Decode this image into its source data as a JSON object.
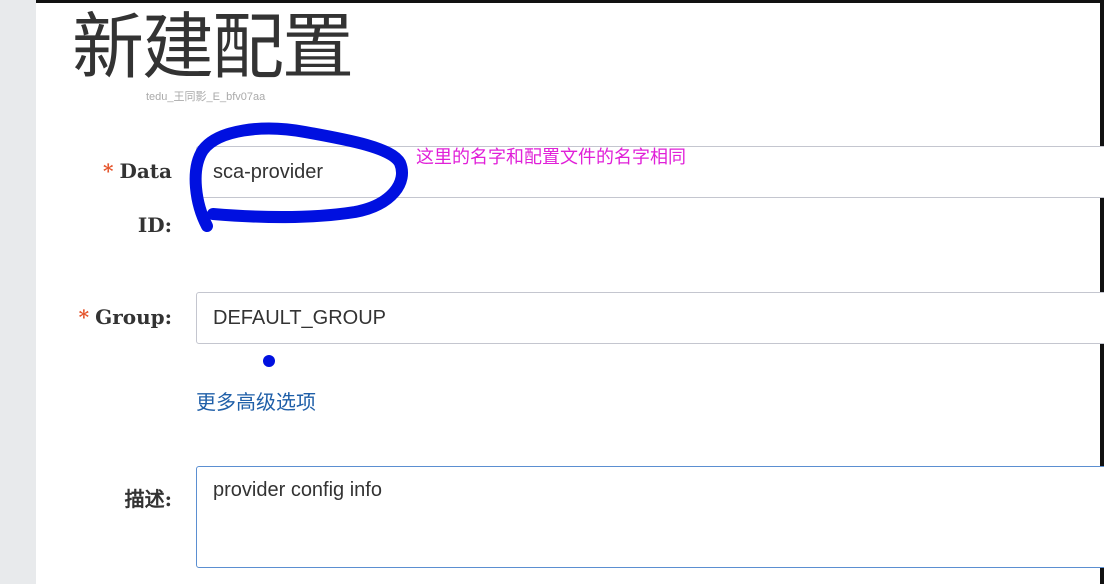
{
  "form": {
    "title": "新建配置",
    "watermark": "tedu_王同影_E_bfv07aa",
    "data_id": {
      "required_mark": "*",
      "label_line1": "Data",
      "label_line2": "ID:",
      "value": "sca-provider"
    },
    "group": {
      "required_mark": "*",
      "label": "Group:",
      "value": "DEFAULT_GROUP"
    },
    "advanced_link": "更多高级选项",
    "description": {
      "label": "描述:",
      "value": "provider config info"
    }
  },
  "annotation": {
    "text": "这里的名字和配置文件的名字相同",
    "color": "#e020d8",
    "ink_color": "#0010e0"
  }
}
